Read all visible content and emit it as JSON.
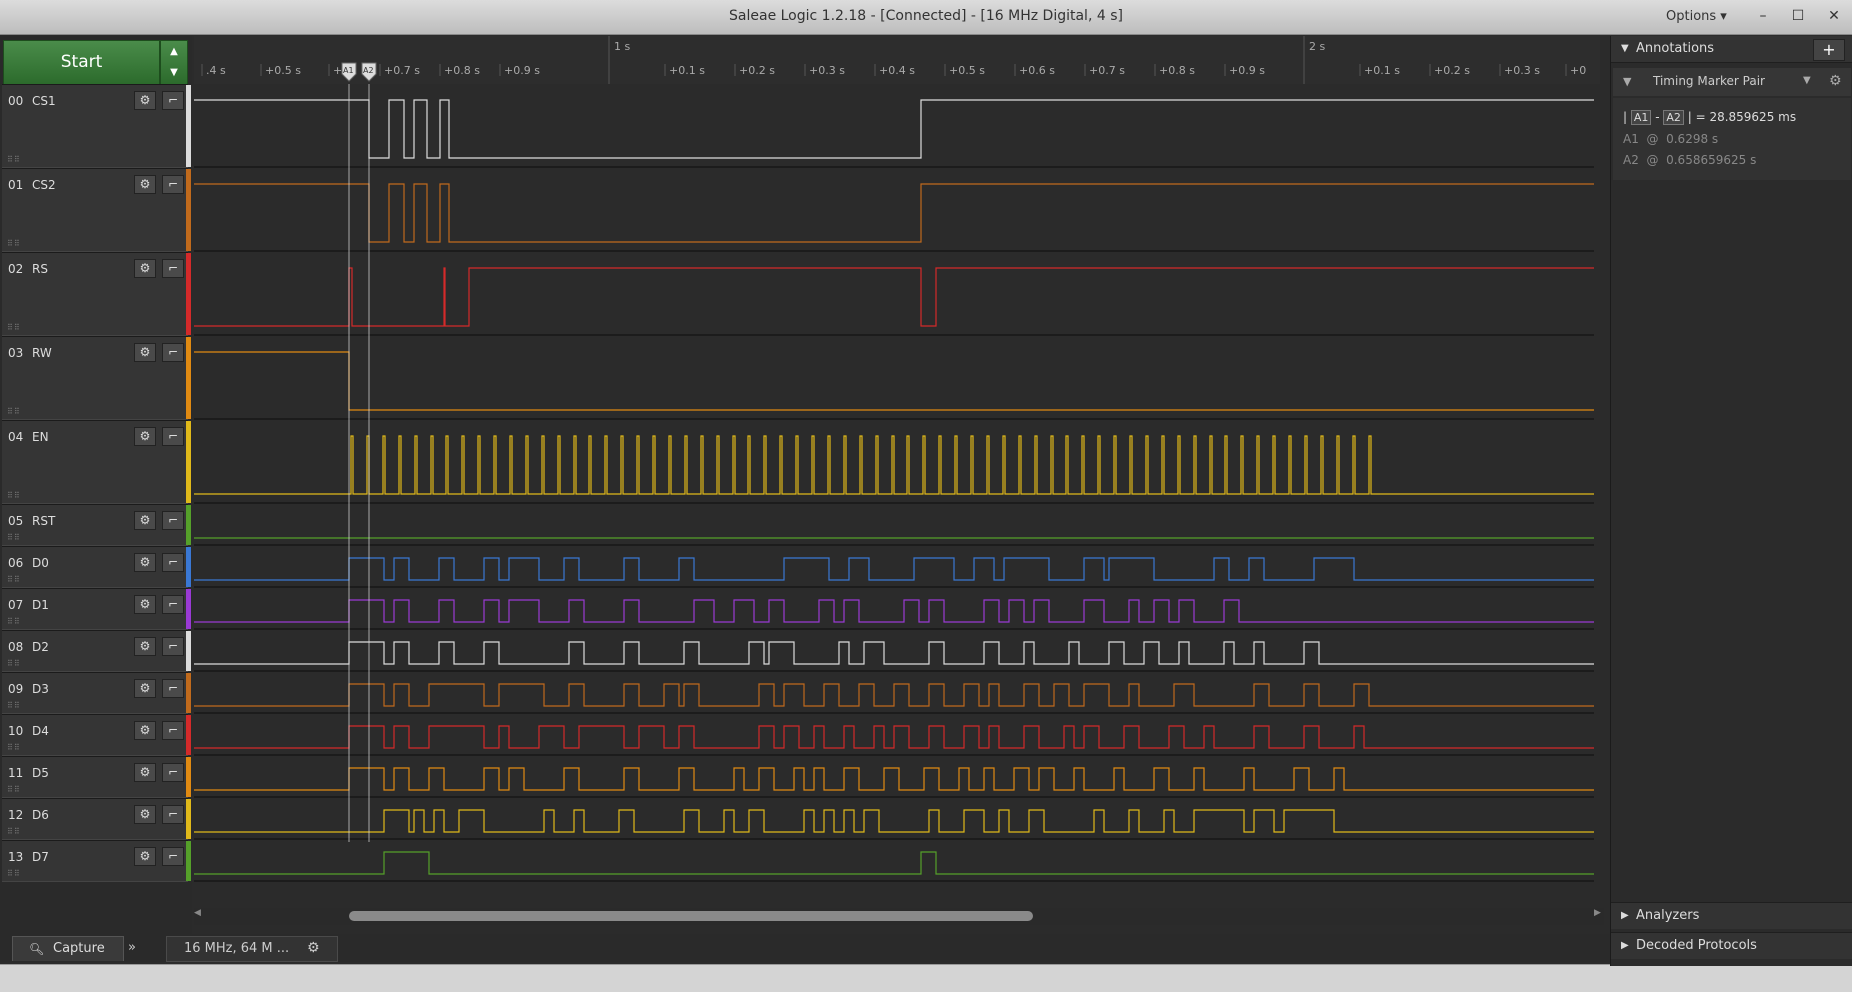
{
  "window": {
    "title": "Saleae Logic 1.2.18 - [Connected] - [16 MHz Digital, 4 s]",
    "options_label": "Options ▾",
    "minimize": "–",
    "maximize": "☐",
    "close": "✕"
  },
  "start_button": {
    "label": "Start"
  },
  "channels": [
    {
      "num": "00",
      "name": "CS1",
      "color": "#dcdcdc"
    },
    {
      "num": "01",
      "name": "CS2",
      "color": "#c06a1c"
    },
    {
      "num": "02",
      "name": "RS",
      "color": "#d42a2a"
    },
    {
      "num": "03",
      "name": "RW",
      "color": "#e08a12"
    },
    {
      "num": "04",
      "name": "EN",
      "color": "#e0b91a"
    },
    {
      "num": "05",
      "name": "RST",
      "color": "#55a02a"
    },
    {
      "num": "06",
      "name": "D0",
      "color": "#3a78d4"
    },
    {
      "num": "07",
      "name": "D1",
      "color": "#9a3ad4"
    },
    {
      "num": "08",
      "name": "D2",
      "color": "#dcdcdc"
    },
    {
      "num": "09",
      "name": "D3",
      "color": "#c06a1c"
    },
    {
      "num": "10",
      "name": "D4",
      "color": "#d42a2a"
    },
    {
      "num": "11",
      "name": "D5",
      "color": "#e08a12"
    },
    {
      "num": "12",
      "name": "D6",
      "color": "#e0b91a"
    },
    {
      "num": "13",
      "name": "D7",
      "color": "#55a02a"
    }
  ],
  "ruler": {
    "major_labels": [
      "1 s",
      "2 s"
    ],
    "minor_labels": [
      ".4 s",
      "+0.5 s",
      "+0.",
      "+0.7 s",
      "+0.8 s",
      "+0.9 s",
      "+0.1 s",
      "+0.2 s",
      "+0.3 s",
      "+0.4 s",
      "+0.5 s",
      "+0.6 s",
      "+0.7 s",
      "+0.8 s",
      "+0.9 s",
      "+0.1 s",
      "+0.2 s",
      "+0.3 s",
      "+0"
    ]
  },
  "markers": {
    "a1": "A1",
    "a2": "A2"
  },
  "capture": {
    "tab_label": "Capture",
    "sample_rate": "16 MHz, 64 M ..."
  },
  "annotations": {
    "header": "Annotations",
    "add_label": "+",
    "marker_type": "Timing Marker Pair",
    "pair_a1": "A1",
    "pair_a2": "A2",
    "delta_value": "28.859625 ms",
    "a1_label": "A1",
    "a1_value": "0.6298 s",
    "a2_label": "A2",
    "a2_value": "0.658659625 s"
  },
  "panels": {
    "analyzers": "Analyzers",
    "decoded_protocols": "Decoded Protocols"
  }
}
